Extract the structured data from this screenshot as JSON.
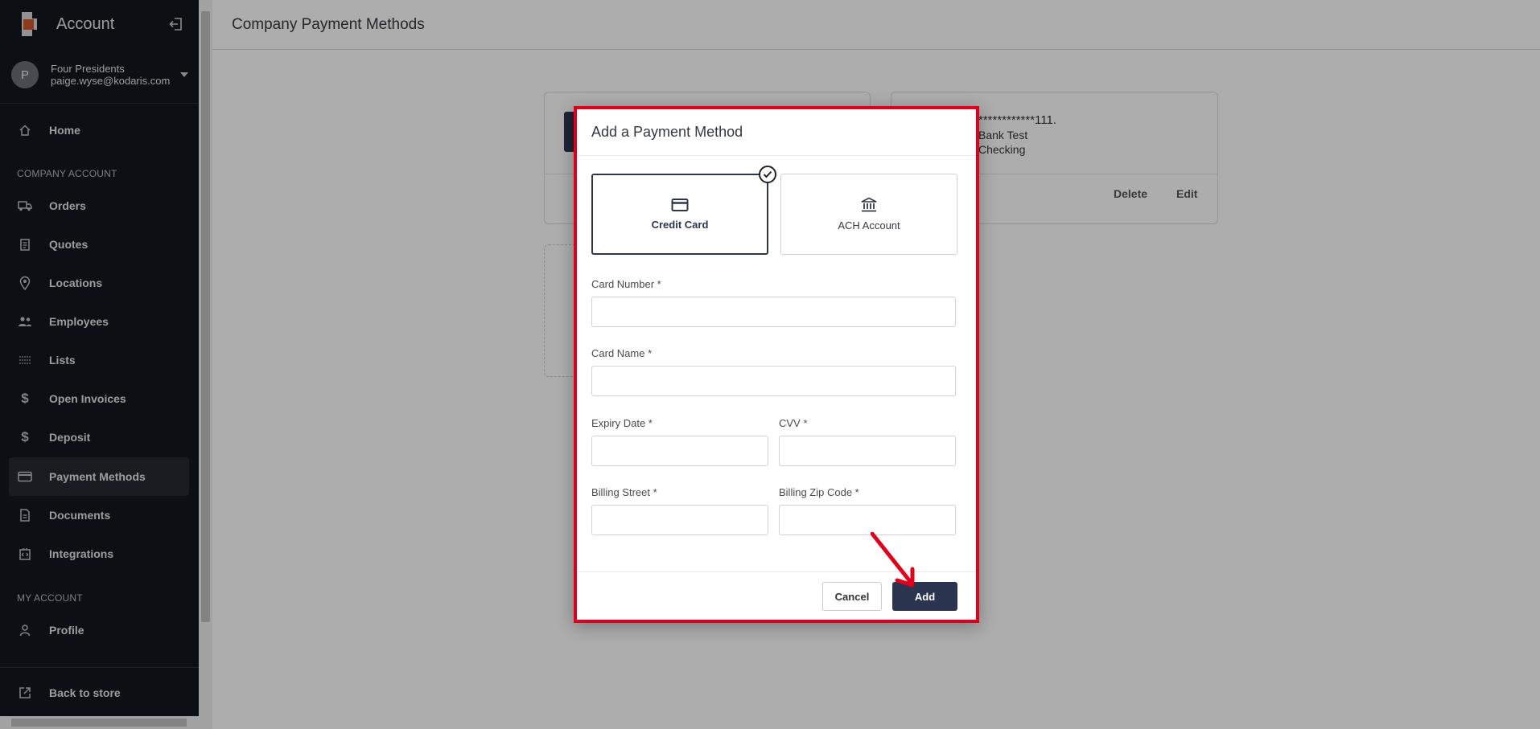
{
  "sidebar": {
    "title": "Account",
    "user": {
      "avatar_letter": "P",
      "company": "Four Presidents",
      "email": "paige.wyse@kodaris.com"
    },
    "items": [
      {
        "label": "Home",
        "icon": "home-icon"
      },
      {
        "label": "Orders",
        "icon": "truck-icon"
      },
      {
        "label": "Quotes",
        "icon": "clipboard-icon"
      },
      {
        "label": "Locations",
        "icon": "map-pin-icon"
      },
      {
        "label": "Employees",
        "icon": "users-icon"
      },
      {
        "label": "Lists",
        "icon": "list-icon"
      },
      {
        "label": "Open Invoices",
        "icon": "dollar-icon"
      },
      {
        "label": "Deposit",
        "icon": "dollar-icon"
      },
      {
        "label": "Payment Methods",
        "icon": "credit-card-icon",
        "active": true
      },
      {
        "label": "Documents",
        "icon": "document-icon"
      },
      {
        "label": "Integrations",
        "icon": "integrations-icon"
      },
      {
        "label": "Profile",
        "icon": "person-icon"
      },
      {
        "label": "Back to store",
        "icon": "external-link-icon"
      }
    ],
    "sections": {
      "company": "COMPANY ACCOUNT",
      "my_account": "MY ACCOUNT"
    }
  },
  "main": {
    "title": "Company Payment Methods",
    "bank_card": {
      "masked_number": "************111.",
      "name": "Bank Test",
      "type": "Checking",
      "delete_label": "Delete",
      "edit_label": "Edit"
    }
  },
  "modal": {
    "title": "Add a Payment Method",
    "methods": [
      {
        "label": "Credit Card",
        "selected": true
      },
      {
        "label": "ACH Account",
        "selected": false
      }
    ],
    "fields": {
      "card_number": "Card Number *",
      "card_name": "Card Name *",
      "expiry": "Expiry Date *",
      "cvv": "CVV *",
      "street": "Billing Street *",
      "zip": "Billing Zip Code *"
    },
    "cancel_label": "Cancel",
    "add_label": "Add"
  },
  "colors": {
    "primary": "#2c3550",
    "highlight": "#e0001b",
    "sidebar_bg": "#13171d"
  }
}
